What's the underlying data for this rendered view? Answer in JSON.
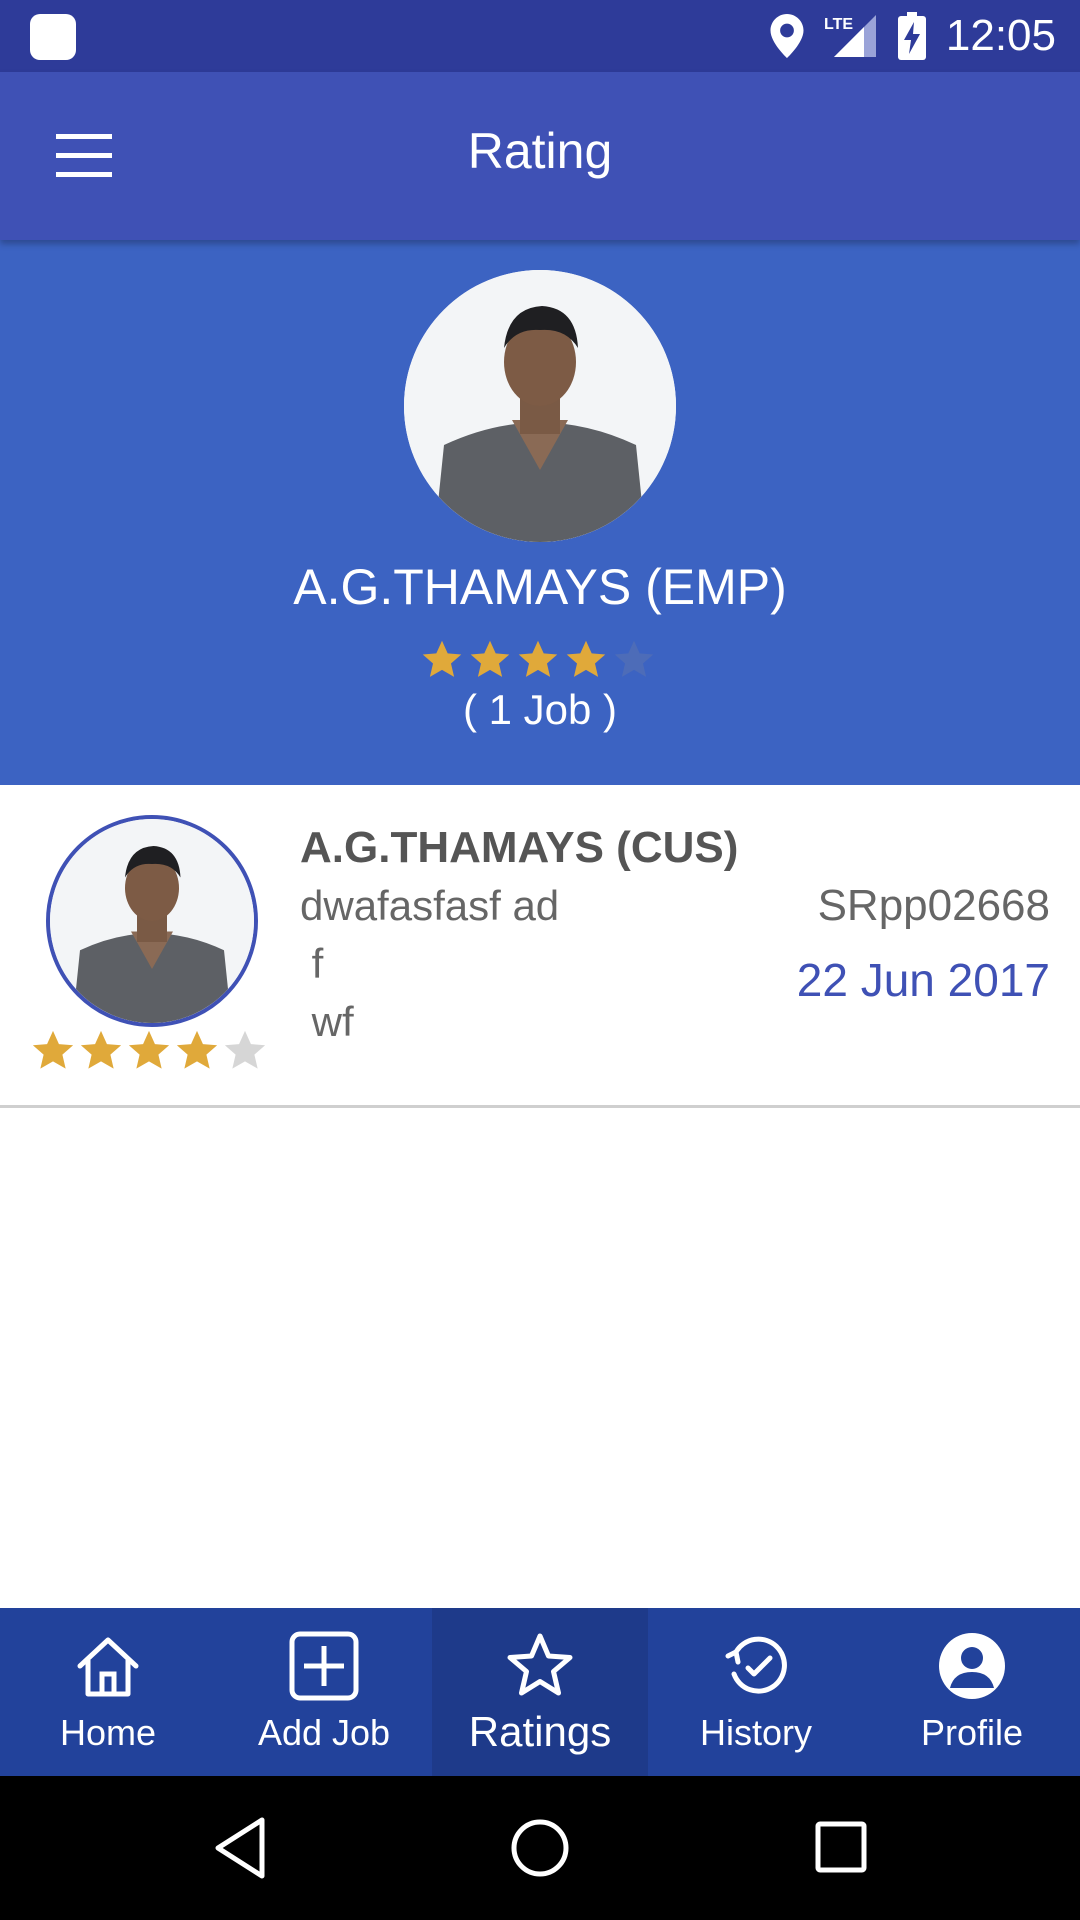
{
  "status_bar": {
    "time": "12:05",
    "network": "LTE"
  },
  "app_bar": {
    "title": "Rating"
  },
  "employee": {
    "name": "A.G.THAMAYS (EMP)",
    "rating": 4,
    "max_rating": 5,
    "jobs_text": "( 1 Job )"
  },
  "ratings_list": [
    {
      "name": "A.G.THAMAYS (CUS)",
      "comment": "dwafasfasf ad\n f\n wf",
      "code": "SRpp02668",
      "date": "22 Jun 2017",
      "rating": 4,
      "max_rating": 5
    }
  ],
  "bottom_nav": {
    "items": [
      {
        "label": "Home",
        "icon": "home-icon"
      },
      {
        "label": "Add Job",
        "icon": "add-box-icon"
      },
      {
        "label": "Ratings",
        "icon": "star-outline-icon",
        "active": true
      },
      {
        "label": "History",
        "icon": "history-icon"
      },
      {
        "label": "Profile",
        "icon": "account-circle-icon"
      }
    ]
  },
  "colors": {
    "status_bar": "#2e3b99",
    "app_bar": "#3f51b5",
    "hero": "#3c63c2",
    "bottom_nav": "#22429b",
    "star_filled": "#e0a93a",
    "accent_text": "#3f51b5"
  }
}
